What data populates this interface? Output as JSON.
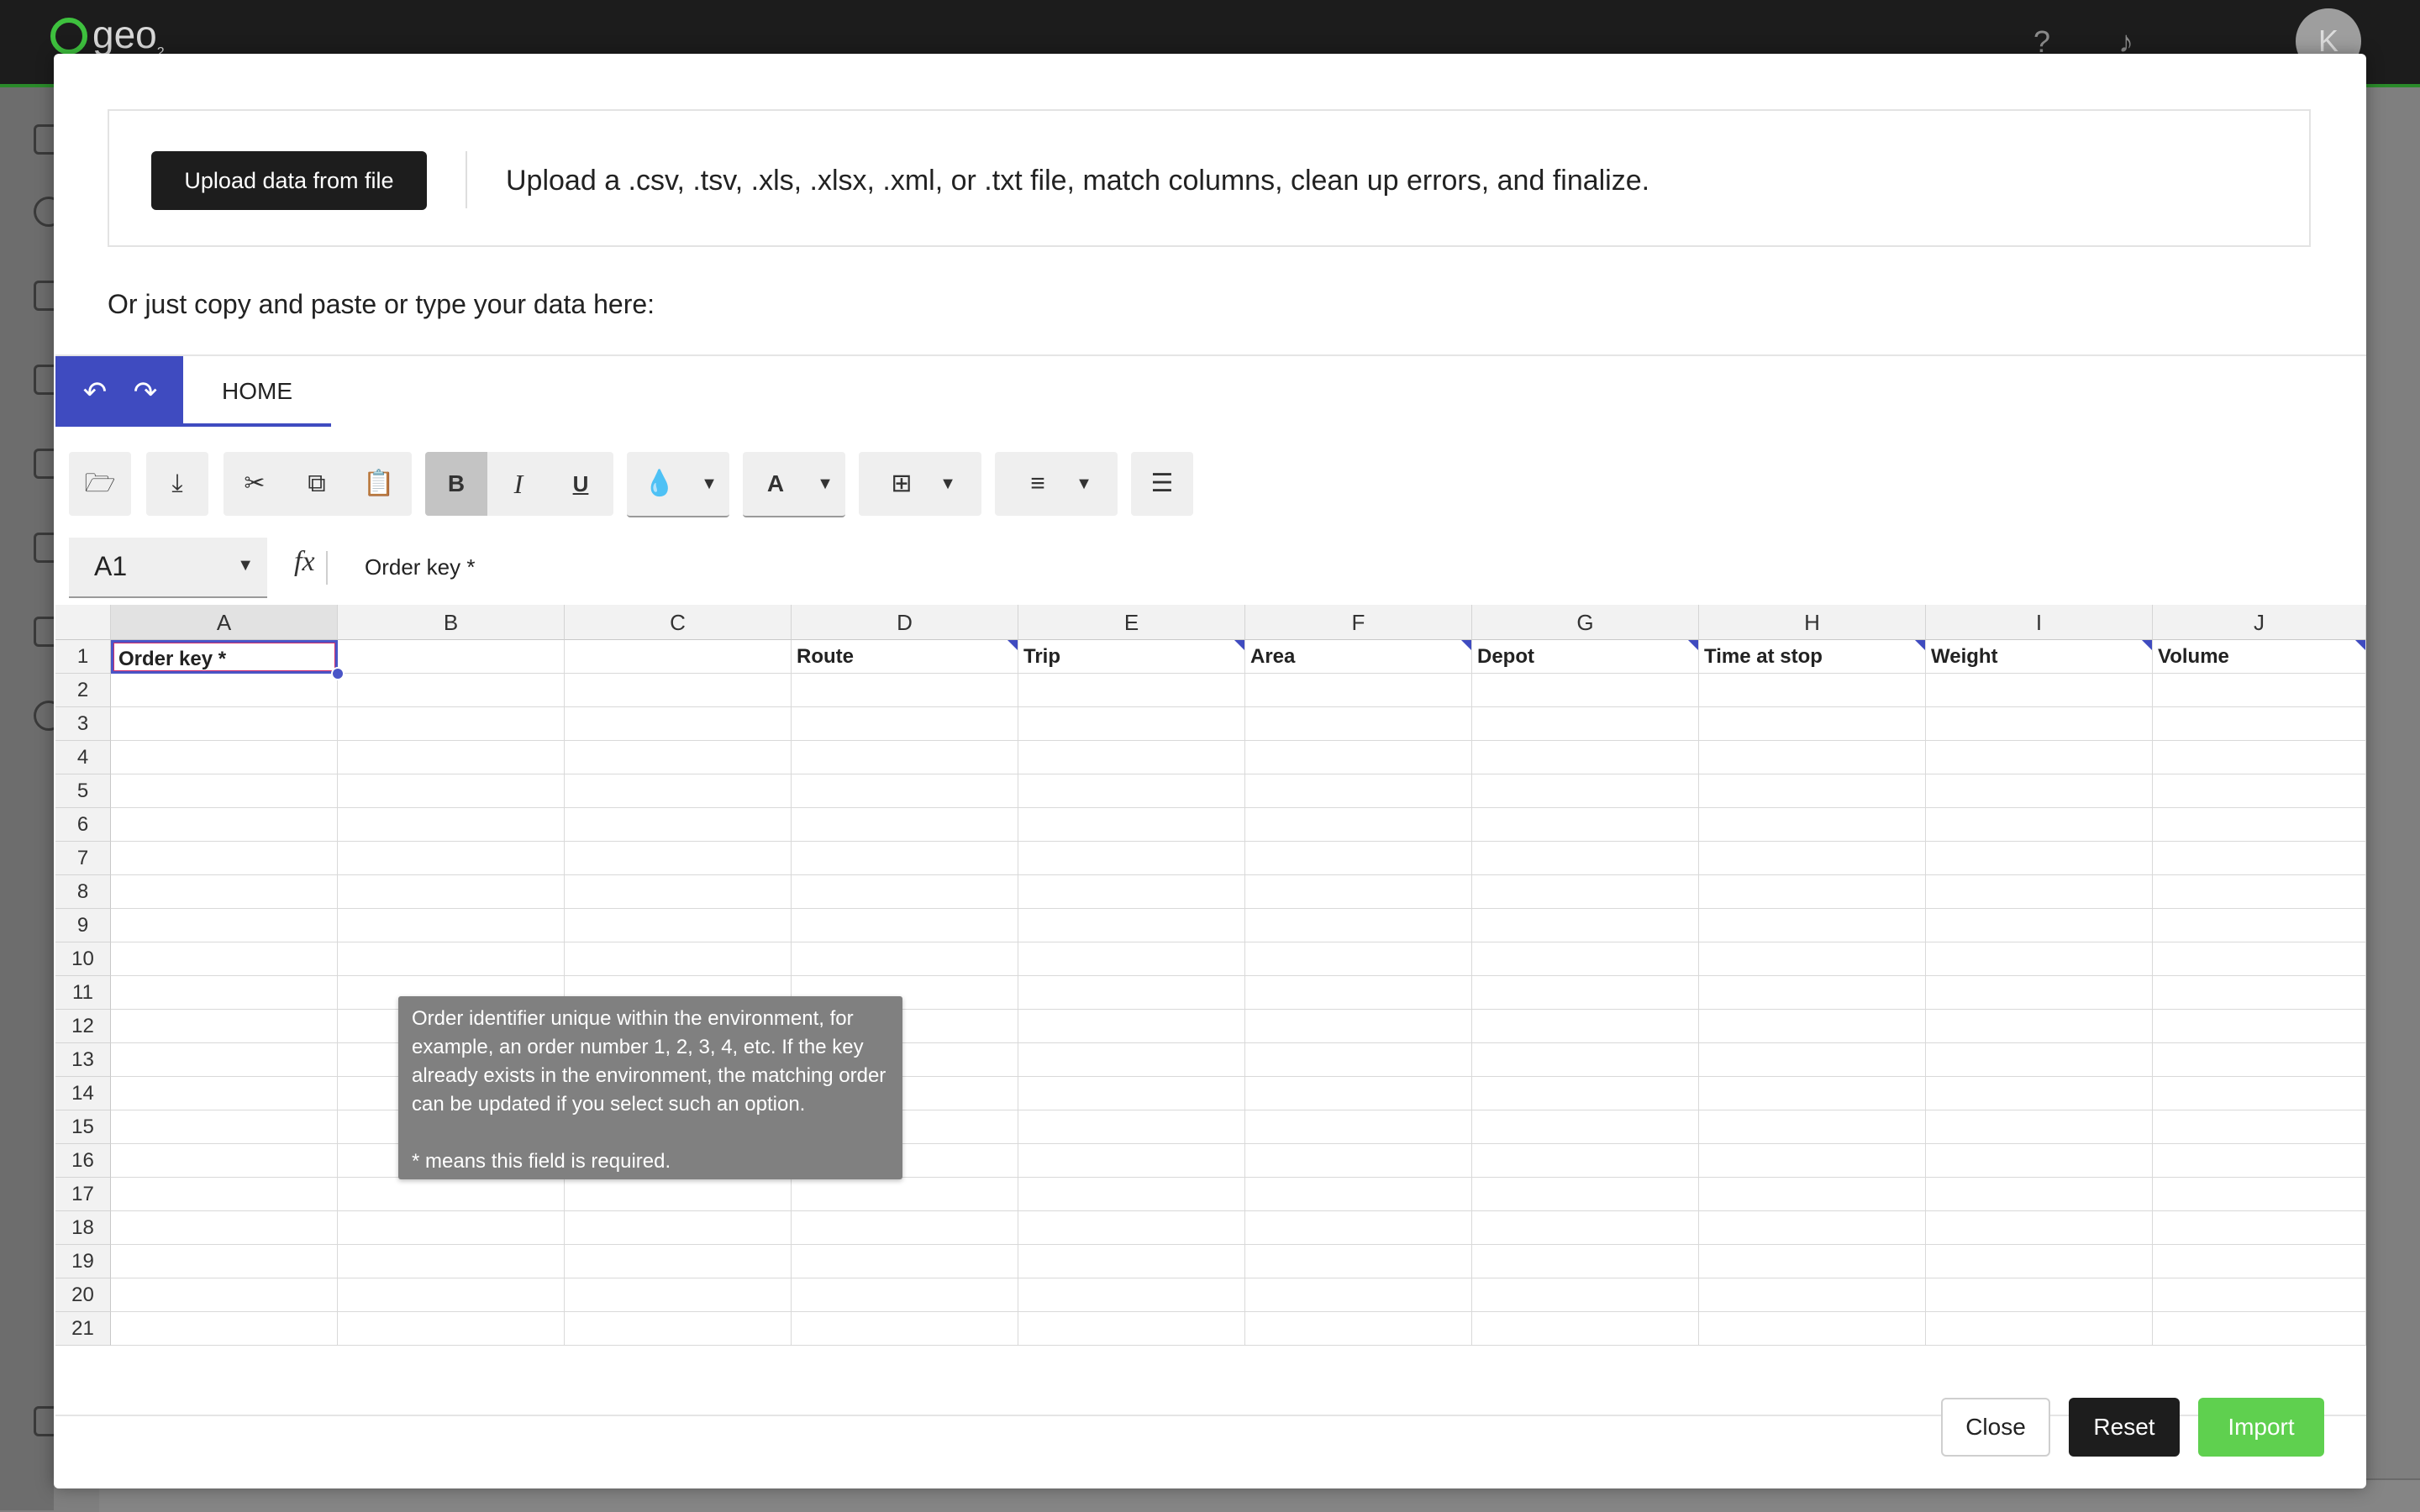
{
  "app": {
    "logo_text": "geo",
    "logo_sub": "2",
    "user_initial": "K"
  },
  "modal": {
    "upload_button": "Upload data from file",
    "upload_description": "Upload a .csv, .tsv, .xls, .xlsx, .xml, or .txt file, match columns, clean up errors, and finalize.",
    "paste_prompt": "Or just copy and paste or type your data here:"
  },
  "ribbon": {
    "home_tab": "HOME"
  },
  "toolbar": {
    "bold": "B",
    "italic": "I",
    "underline": "U",
    "font_color": "A"
  },
  "formula_bar": {
    "cell_ref": "A1",
    "fx": "fx",
    "value": "Order key *"
  },
  "sheet": {
    "columns": [
      "A",
      "B",
      "C",
      "D",
      "E",
      "F",
      "G",
      "H",
      "I",
      "J"
    ],
    "rows": [
      "1",
      "2",
      "3",
      "4",
      "5",
      "6",
      "7",
      "8",
      "9",
      "10",
      "11",
      "12",
      "13",
      "14",
      "15",
      "16",
      "17",
      "18",
      "19",
      "20",
      "21"
    ],
    "headers": [
      "Order key *",
      "",
      "",
      "Route",
      "Trip",
      "Area",
      "Depot",
      "Time at stop",
      "Weight",
      "Volume"
    ]
  },
  "tooltip": {
    "text": "Order identifier unique within the environment, for example, an order number 1, 2, 3, 4, etc. If the key already exists in the environment, the matching order can be updated if you select such an option.",
    "required_note": "* means this field is required."
  },
  "footer": {
    "close": "Close",
    "reset": "Reset",
    "import": "Import"
  },
  "colors": {
    "accent": "#3f4bc0",
    "import": "#5fd04f",
    "dark": "#1d1d1d",
    "brand_green": "#3ec13e"
  }
}
